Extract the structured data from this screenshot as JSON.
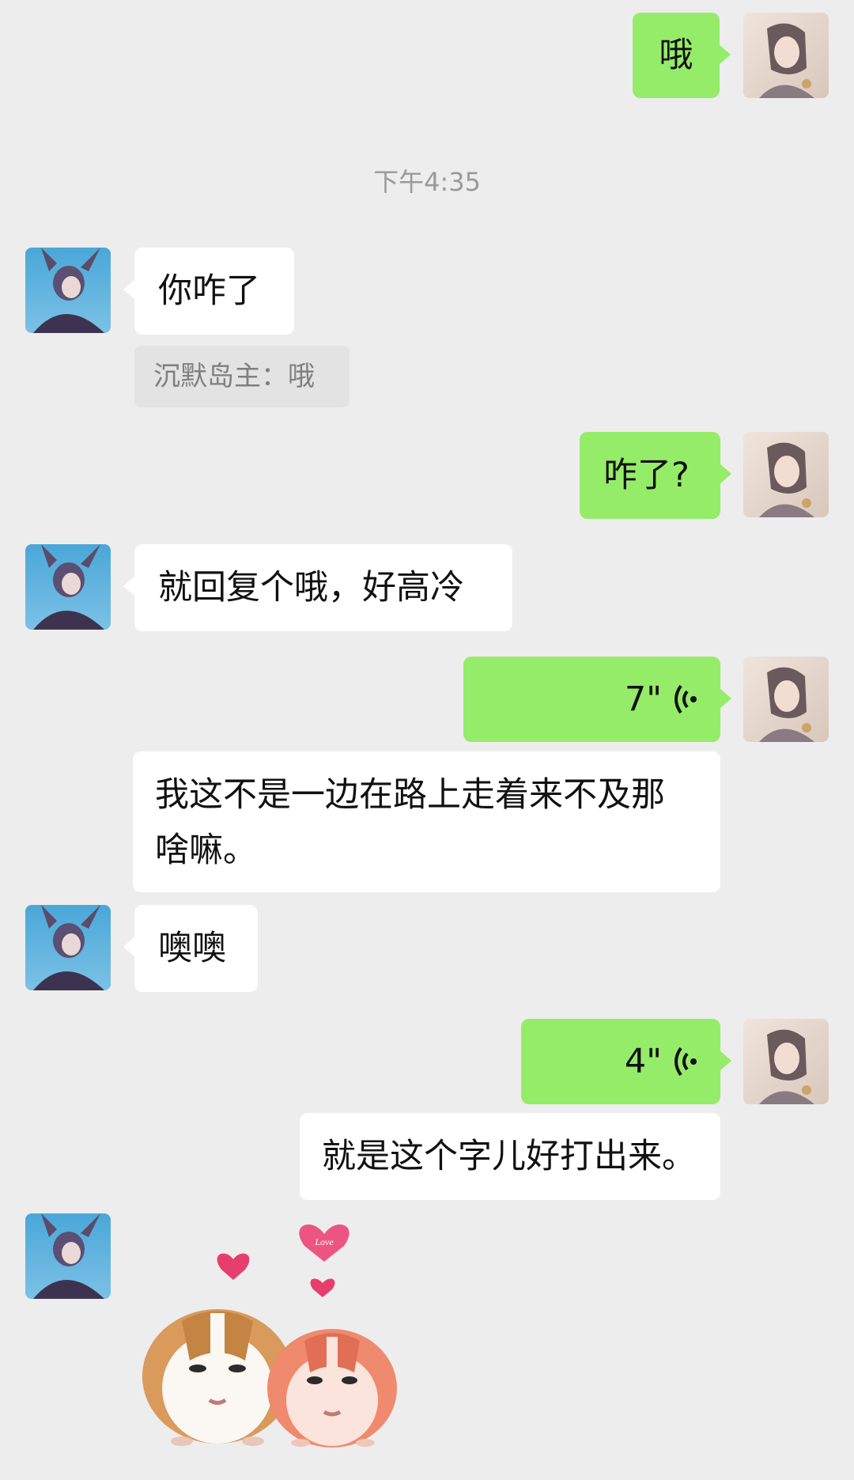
{
  "timestamp": "下午4:35",
  "messages": {
    "m1": "哦",
    "m2": "你咋了",
    "m2_quote": "沉默岛主：哦",
    "m3": "咋了?",
    "m4": "就回复个哦，好高冷",
    "m5_voice": "7\"",
    "m5_transcript": "我这不是一边在路上走着来不及那啥嘛。",
    "m6": "噢噢",
    "m7_voice": "4\"",
    "m7_transcript": "就是这个字儿好打出来。"
  },
  "sticker": {
    "heart_text": "Love"
  },
  "colors": {
    "my_bubble": "#95ec69",
    "their_bubble": "#ffffff",
    "background": "#ededed"
  }
}
